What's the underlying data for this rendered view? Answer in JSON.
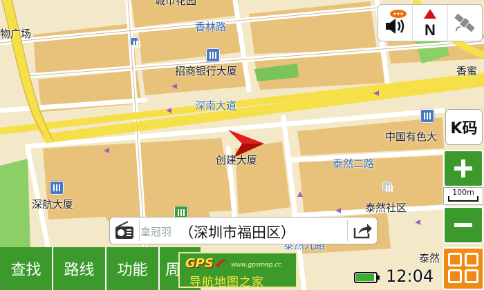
{
  "map": {
    "labels": {
      "top_cut_label": "城市花园",
      "plaza": "物广场",
      "xianglin_road": "香林路",
      "cmb_building": "招商银行大厦",
      "xiangmi": "香蜜",
      "shennan_road": "深南大道",
      "china_nonferrous": "中国有色大",
      "chuangjian": "创建大厦",
      "tairan_road2": "泰然二路",
      "shenhang": "深航大厦",
      "tairan_community": "泰然社区",
      "tairan_road9": "泰然九路",
      "tairan_bottom": "泰然"
    }
  },
  "controls": {
    "volume_icon": "speaker-icon",
    "north_label": "N",
    "gps_icon": "satellite-icon",
    "mode_label": "K码",
    "zoom_in_label": "+",
    "zoom_out_label": "−",
    "scale_label": "100m"
  },
  "address_bar": {
    "faded_text": "皇冠羽",
    "location": "（深圳市福田区）"
  },
  "menu": {
    "search": "查找",
    "route": "路线",
    "function": "功能",
    "partial": "周"
  },
  "watermark": {
    "brand": "GPS",
    "url": "www.gpsmap.cc",
    "slogan": "导航地图之家"
  },
  "status": {
    "clock": "12:04",
    "battery_level": 0.86
  },
  "colors": {
    "accent_green": "#3c9a2c",
    "menu_orange": "#f08a12",
    "road_yellow": "#f5e04a",
    "block_tan": "#e8c27a"
  }
}
